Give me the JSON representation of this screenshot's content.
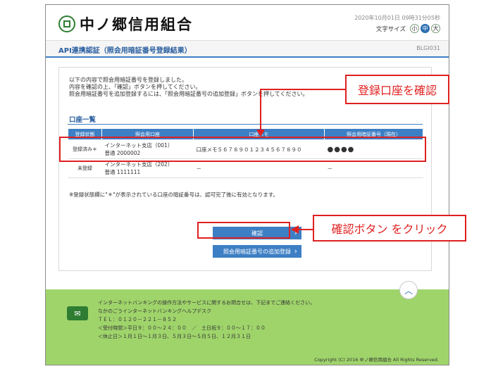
{
  "header": {
    "bank_name": "中ノ郷信用組合",
    "timestamp": "2020年10月01日 09時31分05秒",
    "font_size_label": "文字サイズ",
    "font_sizes": [
      "小",
      "中",
      "大"
    ],
    "active_font_size": "中"
  },
  "title_bar": {
    "title": "API連携認証（照会用暗証番号登録結果）",
    "screen_code": "BLGI031"
  },
  "messages": [
    "以下の内容で照会用暗証番号を登録しました。",
    "内容を確認の上、「確認」ボタンを押してください。",
    "照会用暗証番号を追加登録するには、「照会用暗証番号の追加登録」ボタンを押してください。"
  ],
  "account_section": {
    "title": "口座一覧",
    "columns": [
      "登録状態",
      "照会用口座",
      "口座メモ",
      "照会用暗証番号（現在）"
    ],
    "rows": [
      {
        "status": "登録済み＊",
        "account_line1": "インターネット支店（001）",
        "account_line2": "普通 2000002",
        "memo": "口座メモ５６７８９０１２３４５６７８９０",
        "pin": "●●●●"
      },
      {
        "status": "未登録",
        "account_line1": "インターネット支店（202）",
        "account_line2": "普通 1111111",
        "memo": "－",
        "pin": "－"
      }
    ],
    "note": "※登録状態欄に\"＊\"が表示されている口座の暗証番号は、認可完了後に有効となります。"
  },
  "buttons": {
    "confirm": "確認",
    "add_register": "照会用暗証番号の追加登録"
  },
  "footer": {
    "lines": [
      "インターネットバンキングの操作方法やサービスに関するお問合せは、下記までご連絡ください。",
      "なかのごうインターネットバンキングヘルプデスク",
      "ＴＥＬ：０１２０－２２１－８５２",
      "＜受付時間＞平日９：００～２４：００　／　土日祝９：００～１７：００",
      "＜休止日＞１月１日～１月３日、５月３日～５月５日、１２月３１日"
    ],
    "copyright": "Copyright (C) 2016 中ノ郷信用組合 All Rights Reserved."
  },
  "annotations": {
    "check_account": "登録口座を確認",
    "click_confirm": "確認ボタン をクリック"
  },
  "colors": {
    "accent_blue": "#3d7fc4",
    "footer_green": "#9fd46b",
    "annotation_red": "#e02020",
    "logo_green": "#2e7d32"
  }
}
